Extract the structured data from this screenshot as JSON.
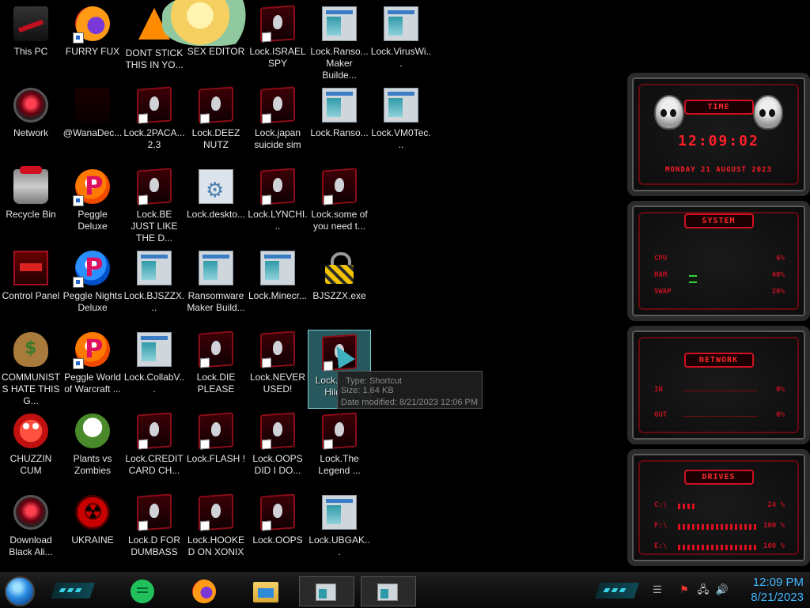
{
  "desktop": {
    "icons": [
      {
        "label": "This PC",
        "icon": "computer-icon"
      },
      {
        "label": "FURRY FUX",
        "icon": "firefox-icon"
      },
      {
        "label": "DONT STICK THIS IN YO...",
        "icon": "traffic-cone-icon"
      },
      {
        "label": "SEX EDITOR",
        "icon": "anime-character-icon"
      },
      {
        "label": "Lock.ISRAEL SPY",
        "icon": "alien-shortcut-icon"
      },
      {
        "label": "Lock.Ranso... Maker Builde...",
        "icon": "window-app-icon"
      },
      {
        "label": "Lock.VirusWi...",
        "icon": "window-app-icon"
      },
      {
        "label": "Network",
        "icon": "alien-orb-icon"
      },
      {
        "label": "@WanaDec...",
        "icon": "dark-app-icon"
      },
      {
        "label": "Lock.2PACA... 2.3",
        "icon": "alien-shortcut-icon"
      },
      {
        "label": "Lock.DEEZ NUTZ",
        "icon": "alien-shortcut-icon"
      },
      {
        "label": "Lock.japan suicide sim",
        "icon": "alien-shortcut-icon"
      },
      {
        "label": "Lock.Ranso...",
        "icon": "window-app-icon"
      },
      {
        "label": "Lock.VM0Tec...",
        "icon": "window-app-icon"
      },
      {
        "label": "Recycle Bin",
        "icon": "recycle-bin-icon"
      },
      {
        "label": "Peggle Deluxe",
        "icon": "peggle-icon"
      },
      {
        "label": "Lock.BE JUST LIKE THE D...",
        "icon": "alien-shortcut-icon"
      },
      {
        "label": "Lock.deskto...",
        "icon": "settings-file-icon"
      },
      {
        "label": "Lock.LYNCHI...",
        "icon": "alien-shortcut-icon"
      },
      {
        "label": "Lock.some of you need t...",
        "icon": "alien-shortcut-icon"
      },
      {
        "label": "Control Panel",
        "icon": "control-panel-icon"
      },
      {
        "label": "Peggle Nights Deluxe",
        "icon": "peggle-nights-icon"
      },
      {
        "label": "Lock.BJSZZX...",
        "icon": "window-app-icon"
      },
      {
        "label": "Ransomware Maker Build...",
        "icon": "window-app-icon"
      },
      {
        "label": "Lock.Minecr...",
        "icon": "window-app-icon"
      },
      {
        "label": "BJSZZX.exe",
        "icon": "padlock-icon"
      },
      {
        "label": "COMMUNISTS HATE THIS G...",
        "icon": "money-bag-icon"
      },
      {
        "label": "Peggle World of Warcraft ...",
        "icon": "peggle-icon"
      },
      {
        "label": "Lock.CollabV...",
        "icon": "window-app-icon"
      },
      {
        "label": "Lock.DIE PLEASE",
        "icon": "alien-shortcut-icon"
      },
      {
        "label": "Lock.NEVER USED!",
        "icon": "alien-shortcut-icon"
      },
      {
        "label": "Lock.Super Hilde...",
        "icon": "alien-shortcut-icon"
      },
      {
        "label": "CHUZZIN CUM",
        "icon": "chuzzle-icon"
      },
      {
        "label": "Plants vs Zombies",
        "icon": "plant-icon"
      },
      {
        "label": "Lock.CREDIT CARD CH...",
        "icon": "alien-shortcut-icon"
      },
      {
        "label": "Lock.FLASH !",
        "icon": "alien-shortcut-icon"
      },
      {
        "label": "Lock.OOPS DID I DO...",
        "icon": "alien-shortcut-icon"
      },
      {
        "label": "Lock.The Legend ...",
        "icon": "alien-shortcut-icon"
      },
      {
        "label": "Download Black Ali...",
        "icon": "alien-orb-icon"
      },
      {
        "label": "UKRAINE",
        "icon": "radiation-icon"
      },
      {
        "label": "Lock.D FOR DUMBASS",
        "icon": "alien-shortcut-icon"
      },
      {
        "label": "Lock.HOOKED ON XONIX",
        "icon": "alien-shortcut-icon"
      },
      {
        "label": "Lock.OOPS",
        "icon": "alien-shortcut-icon"
      },
      {
        "label": "Lock.UBGAK...",
        "icon": "window-app-icon"
      }
    ],
    "tooltip": {
      "type": "Type: Shortcut",
      "size": "Size: 1.64 KB",
      "modified": "Date modified: 8/21/2023 12:06 PM"
    }
  },
  "widgets": {
    "time": {
      "title": "TIME",
      "clock": "12:09:02",
      "date": "MONDAY 21 AUGUST 2023"
    },
    "system": {
      "title": "SYSTEM",
      "rows": [
        {
          "label": "CPU",
          "value": "6%"
        },
        {
          "label": "RAM",
          "value": "40%"
        },
        {
          "label": "SWAP",
          "value": "26%"
        }
      ]
    },
    "network": {
      "title": "NETWORK",
      "rows": [
        {
          "label": "IN",
          "value": "0%"
        },
        {
          "label": "OUT",
          "value": "0%"
        }
      ]
    },
    "drives": {
      "title": "DRIVES",
      "rows": [
        {
          "label": "C:\\",
          "value": "24 %",
          "fill": 0.24
        },
        {
          "label": "F:\\",
          "value": "100 %",
          "fill": 1.0
        },
        {
          "label": "E:\\",
          "value": "100 %",
          "fill": 1.0
        }
      ]
    },
    "accent": "#ff1e2a"
  },
  "taskbar": {
    "clock_time": "12:09 PM",
    "clock_date": "8/21/2023",
    "apps": [
      "chat-app-icon",
      "firefox-icon",
      "file-explorer-icon",
      "window-app-icon",
      "window-app-icon"
    ],
    "tray": [
      "flag-icon",
      "network-icon",
      "speaker-icon"
    ],
    "clock_color": "#3fb6ff"
  }
}
